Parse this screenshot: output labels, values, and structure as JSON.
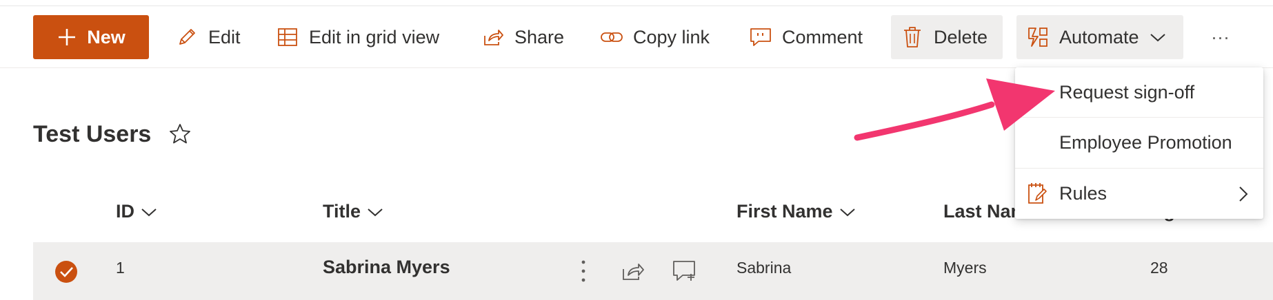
{
  "toolbar": {
    "new_label": "New",
    "edit_label": "Edit",
    "grid_label": "Edit in grid view",
    "share_label": "Share",
    "copy_link_label": "Copy link",
    "comment_label": "Comment",
    "delete_label": "Delete",
    "automate_label": "Automate",
    "more_label": "···"
  },
  "list": {
    "title": "Test Users",
    "columns": [
      "ID",
      "Title",
      "First Name",
      "Last Name",
      "Age"
    ],
    "rows": [
      {
        "id": "1",
        "title": "Sabrina Myers",
        "first_name": "Sabrina",
        "last_name": "Myers",
        "age": "28"
      }
    ]
  },
  "automate_menu": {
    "items": [
      {
        "label": "Request sign-off"
      },
      {
        "label": "Employee Promotion"
      },
      {
        "label": "Rules"
      }
    ]
  },
  "colors": {
    "accent": "#ca5010",
    "annotation_arrow": "#f2366f",
    "selected_row": "#efeeed"
  }
}
